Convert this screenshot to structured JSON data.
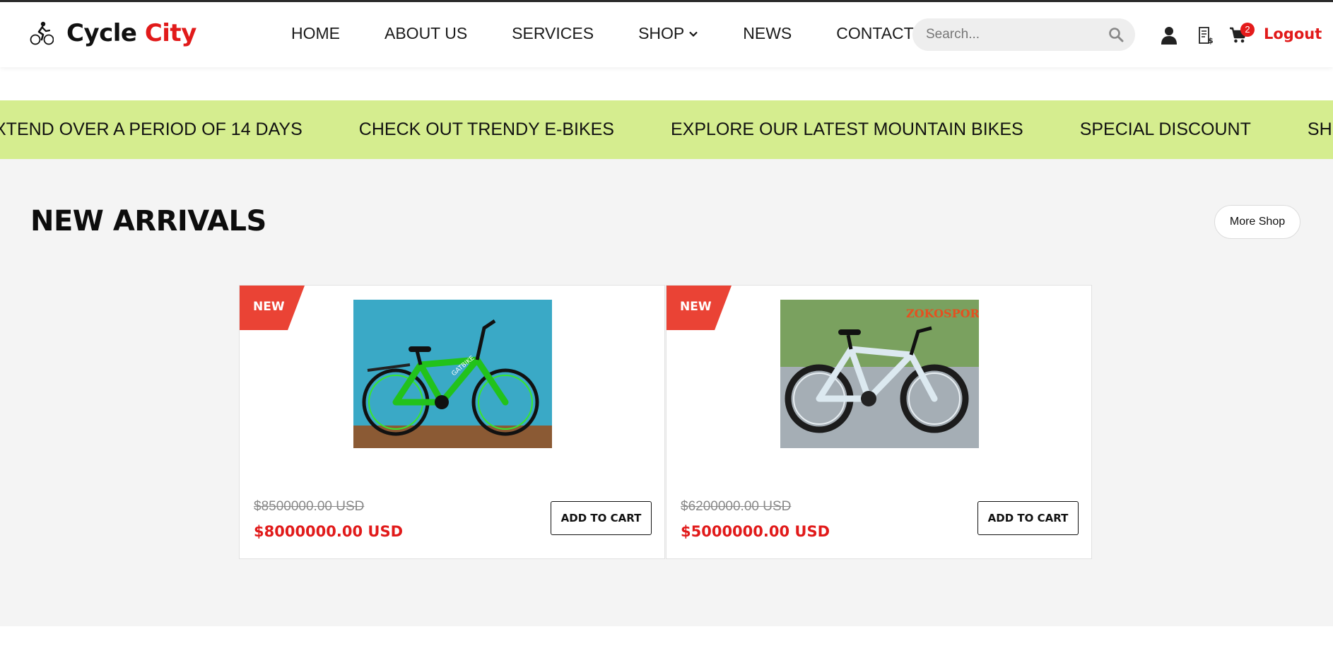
{
  "brand": {
    "name_part1": "Cycle",
    "name_part2": "City"
  },
  "nav": {
    "items": [
      {
        "label": "HOME"
      },
      {
        "label": "ABOUT US"
      },
      {
        "label": "SERVICES"
      },
      {
        "label": "SHOP"
      },
      {
        "label": "NEWS"
      },
      {
        "label": "CONTACT"
      }
    ]
  },
  "search": {
    "placeholder": "Search..."
  },
  "cart": {
    "count": "2"
  },
  "header_actions": {
    "logout_label": "Logout"
  },
  "ticker": {
    "items": [
      "XTEND OVER A PERIOD OF 14 DAYS",
      "CHECK OUT TRENDY E-BIKES",
      "EXPLORE OUR LATEST MOUNTAIN BIKES",
      "SPECIAL DISCOUNT",
      "SHIPPING THRO"
    ]
  },
  "section": {
    "title": "NEW ARRIVALS",
    "more_label": "More Shop"
  },
  "products": [
    {
      "badge": "NEW",
      "old_price": "$8500000.00 USD",
      "price": "$8000000.00 USD",
      "cta": "ADD TO CART",
      "image_text": "GATBIKE"
    },
    {
      "badge": "NEW",
      "old_price": "$6200000.00 USD",
      "price": "$5000000.00 USD",
      "cta": "ADD TO CART",
      "image_text": "ZOKOSPORT"
    }
  ],
  "colors": {
    "accent": "#e11a1a",
    "ticker_bg": "#d5ed8f",
    "badge_bg": "#ea4335",
    "page_bg": "#f4f4f4"
  }
}
